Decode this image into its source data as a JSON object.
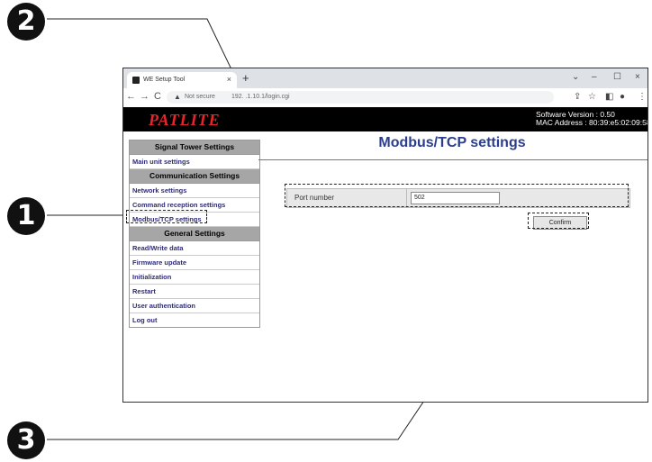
{
  "callouts": [
    "2",
    "1",
    "3"
  ],
  "browser": {
    "tab_title": "WE Setup Tool",
    "tab_close": "×",
    "new_tab": "+",
    "window_controls": [
      "⌄",
      "–",
      "☐",
      "×"
    ],
    "nav": [
      "←",
      "→",
      "C"
    ],
    "security_label": "Not secure",
    "url": "192.  .1.10.1/login.cgi",
    "toolbar_icons": [
      "share-icon",
      "star-icon",
      "sidebar-icon",
      "profile-icon",
      "menu-icon"
    ]
  },
  "header": {
    "logo": "PATLITE",
    "software_version": "Software Version : 0.50",
    "mac_address": "MAC Address : 80:39:e5:02:09:58"
  },
  "sidebar": {
    "sections": [
      {
        "heading": "Signal Tower Settings",
        "items": [
          "Main unit settings"
        ]
      },
      {
        "heading": "Communication Settings",
        "items": [
          "Network settings",
          "Command reception settings",
          "Modbus/TCP settings"
        ]
      },
      {
        "heading": "General Settings",
        "items": [
          "Read/Write data",
          "Firmware update",
          "Initialization",
          "Restart",
          "User authentication",
          "Log out"
        ]
      }
    ]
  },
  "main": {
    "title": "Modbus/TCP settings",
    "port_label": "Port number",
    "port_value": "502",
    "confirm_label": "Confirm"
  },
  "colors": {
    "logo": "#e8242a",
    "title": "#2b3d8f",
    "link": "#2d2d7a"
  }
}
